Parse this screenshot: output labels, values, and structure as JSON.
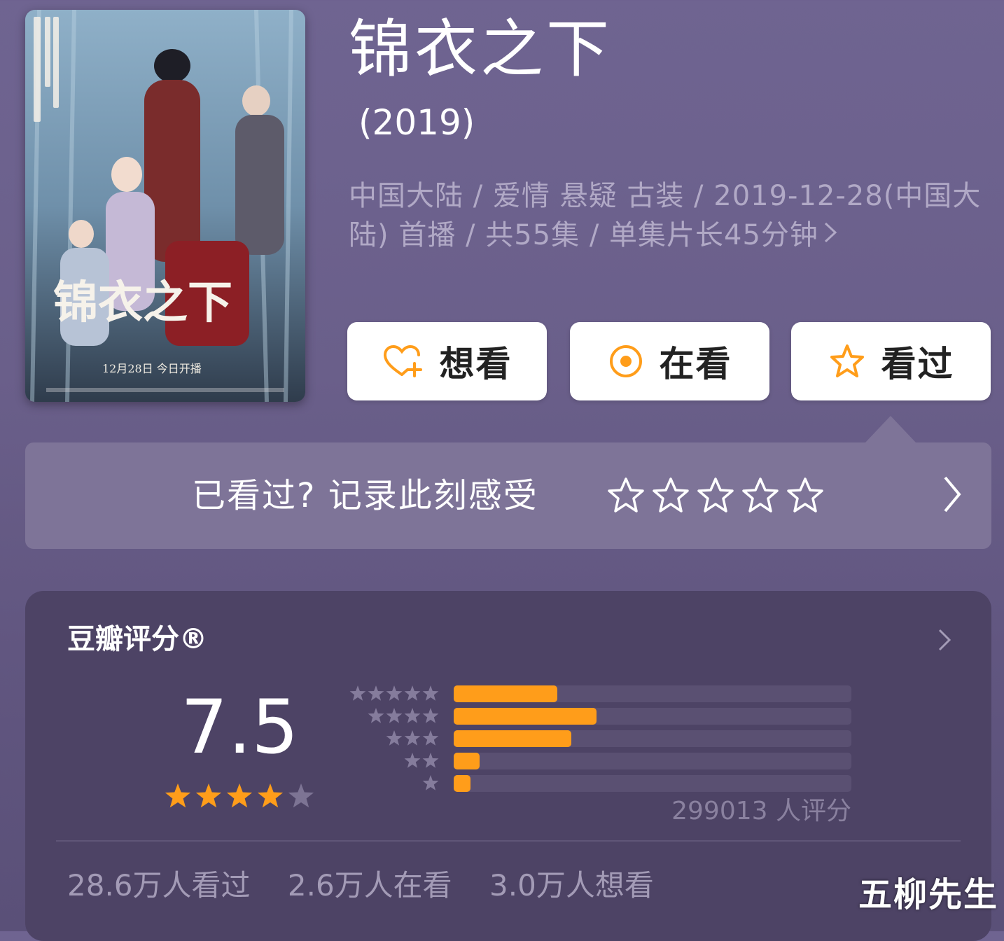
{
  "show": {
    "title": "锦衣之下",
    "year": "(2019)",
    "meta_line": "中国大陆 / 爱情 悬疑 古装 / 2019-12-28(中国大陆) 首播 / 共55集 / 单集片长45分钟"
  },
  "poster": {
    "title_text": "锦衣之下",
    "date_text": "12月28日 今日开播"
  },
  "actions": {
    "want": {
      "label": "想看",
      "icon": "heart-plus-icon"
    },
    "watching": {
      "label": "在看",
      "icon": "target-circle-icon"
    },
    "watched": {
      "label": "看过",
      "icon": "star-outline-icon"
    }
  },
  "rate_prompt": {
    "text": "已看过? 记录此刻感受",
    "star_count": 5
  },
  "rating": {
    "header": "豆瓣评分®",
    "score": "7.5",
    "stars": 3.75,
    "votes_text": "299013 人评分",
    "distribution": [
      {
        "stars": 5,
        "fraction": 0.26
      },
      {
        "stars": 4,
        "fraction": 0.36
      },
      {
        "stars": 3,
        "fraction": 0.295
      },
      {
        "stars": 2,
        "fraction": 0.065
      },
      {
        "stars": 1,
        "fraction": 0.04
      }
    ]
  },
  "counts": {
    "watched": "28.6万人看过",
    "watching": "2.6万人在看",
    "want": "3.0万人想看"
  },
  "watermark": "五柳先生",
  "colors": {
    "accent_orange": "#ff9d1a",
    "background": "#6a5f8a",
    "card": "#4d4365"
  }
}
